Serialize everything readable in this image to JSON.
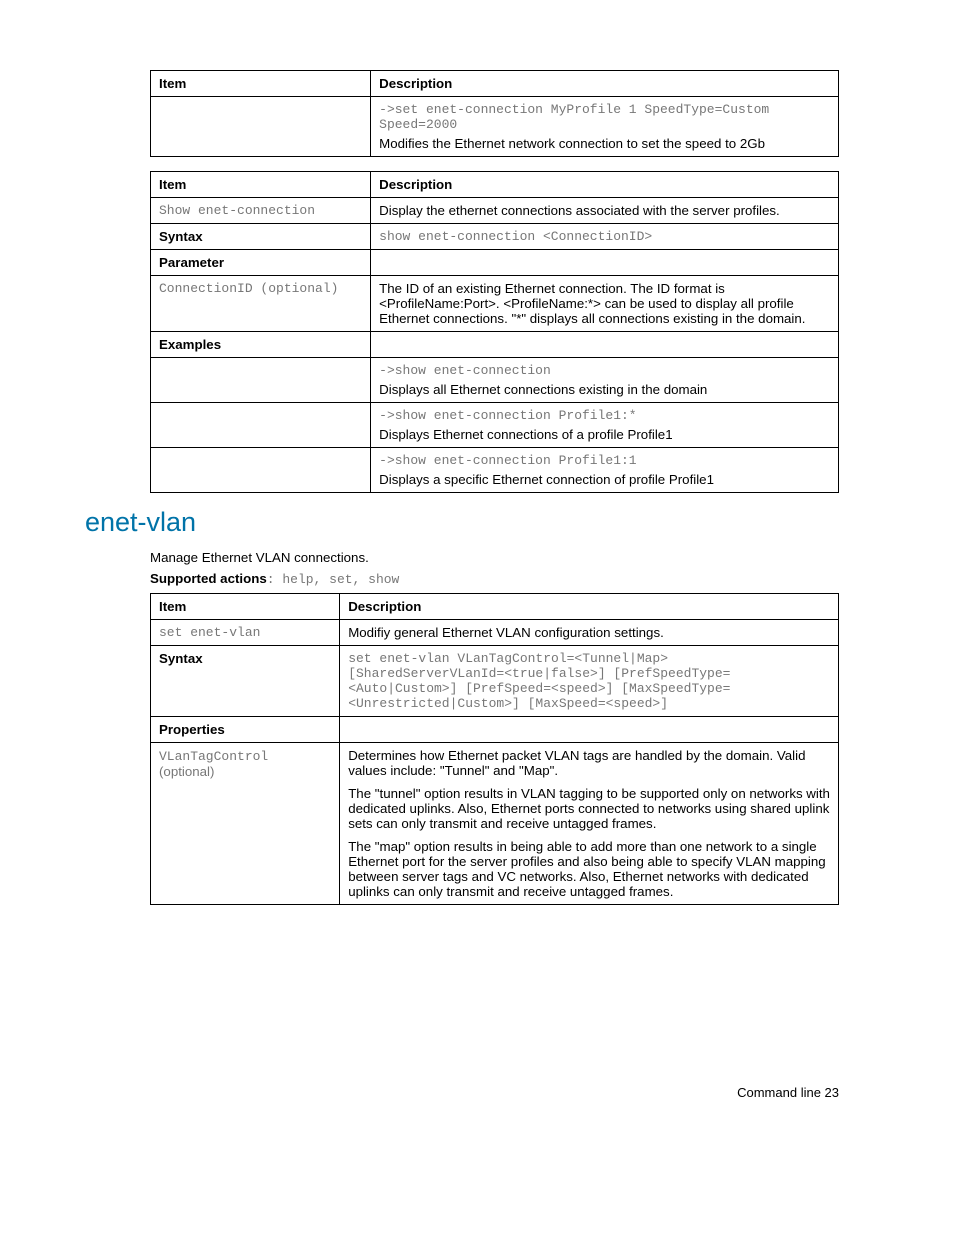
{
  "table1": {
    "h1": "Item",
    "h2": "Description",
    "code": "->set enet-connection MyProfile 1 SpeedType=Custom Speed=2000",
    "desc": "Modifies the Ethernet network connection to set the speed to 2Gb"
  },
  "table2": {
    "h1": "Item",
    "h2": "Description",
    "r1c1": "Show enet-connection",
    "r1c2": "Display the ethernet connections associated with the server profiles.",
    "r2c1": "Syntax",
    "r2c2": "show enet-connection <ConnectionID>",
    "r3c1": "Parameter",
    "r4c1": "ConnectionID (optional)",
    "r4c2": "The ID of an existing Ethernet connection. The ID format is <ProfileName:Port>. <ProfileName:*> can be used to display all profile Ethernet connections. \"*\" displays all connections existing in the domain.",
    "r5c1": "Examples",
    "r6a": "->show enet-connection",
    "r6b": "Displays all Ethernet connections existing in the domain",
    "r7a": "->show enet-connection Profile1:*",
    "r7b": "Displays Ethernet connections of a profile Profile1",
    "r8a": "->show enet-connection Profile1:1",
    "r8b": "Displays a specific Ethernet connection of profile Profile1"
  },
  "section_title": "enet-vlan",
  "section_desc": "Manage Ethernet VLAN connections.",
  "supported_label": "Supported actions",
  "supported_vals": ": help, set, show",
  "table3": {
    "h1": "Item",
    "h2": "Description",
    "r1c1": "set enet-vlan",
    "r1c2": "Modifiy general Ethernet VLAN configuration settings.",
    "r2c1": "Syntax",
    "r2c2": "set enet-vlan VLanTagControl=<Tunnel|Map> [SharedServerVLanId=<true|false>] [PrefSpeedType=<Auto|Custom>] [PrefSpeed=<speed>] [MaxSpeedType=<Unrestricted|Custom>] [MaxSpeed=<speed>]",
    "r3c1": "Properties",
    "r4c1a": "VLanTagControl",
    "r4c1b": "(optional)",
    "r4c2a": "Determines how Ethernet packet VLAN tags are handled by the domain. Valid values include: \"Tunnel\" and \"Map\".",
    "r4c2b": "The \"tunnel\" option results in VLAN tagging to be supported only on networks with dedicated uplinks. Also, Ethernet ports connected to networks using shared uplink sets can only transmit and receive untagged frames.",
    "r4c2c": "The \"map\" option results in being able to add more than one network to a single Ethernet port for the server profiles and also being able to specify VLAN mapping between server tags and VC networks. Also, Ethernet networks with dedicated uplinks can only transmit and receive untagged frames."
  },
  "footer": "Command line   23"
}
